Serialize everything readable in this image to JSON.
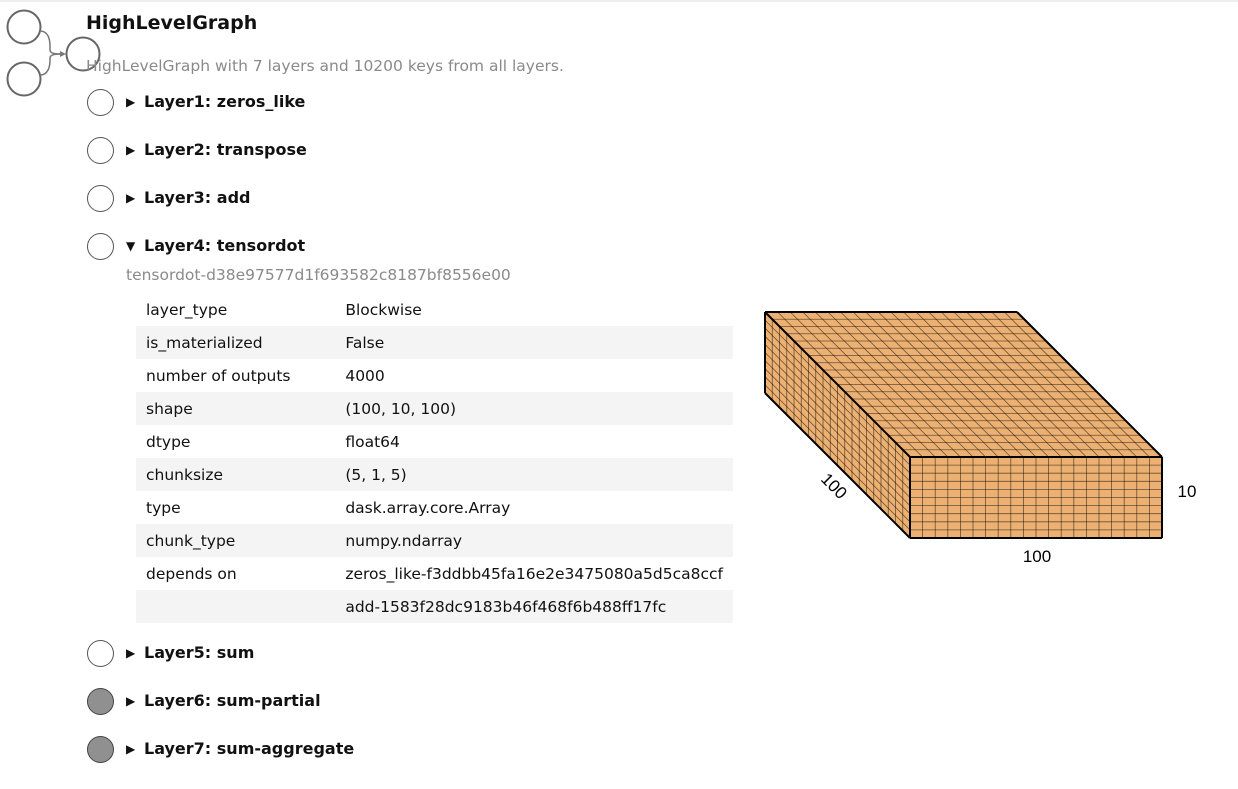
{
  "graph": {
    "title": "HighLevelGraph",
    "summary": "HighLevelGraph with 7 layers and 10200 keys from all layers."
  },
  "layers": [
    {
      "label": "Layer1: zeros_like",
      "expanded": false,
      "materialized": false
    },
    {
      "label": "Layer2: transpose",
      "expanded": false,
      "materialized": false
    },
    {
      "label": "Layer3: add",
      "expanded": false,
      "materialized": false
    },
    {
      "label": "Layer4: tensordot",
      "expanded": true,
      "materialized": false
    },
    {
      "label": "Layer5: sum",
      "expanded": false,
      "materialized": false
    },
    {
      "label": "Layer6: sum-partial",
      "expanded": false,
      "materialized": true
    },
    {
      "label": "Layer7: sum-aggregate",
      "expanded": false,
      "materialized": true
    }
  ],
  "expanded_layer": {
    "name": "tensordot-d38e97577d1f693582c8187bf8556e00",
    "rows": [
      {
        "key": "layer_type",
        "value": "Blockwise"
      },
      {
        "key": "is_materialized",
        "value": "False"
      },
      {
        "key": "number of outputs",
        "value": "4000"
      },
      {
        "key": "shape",
        "value": "(100, 10, 100)"
      },
      {
        "key": "dtype",
        "value": "float64"
      },
      {
        "key": "chunksize",
        "value": "(5, 1, 5)"
      },
      {
        "key": "type",
        "value": "dask.array.core.Array"
      },
      {
        "key": "chunk_type",
        "value": "numpy.ndarray"
      },
      {
        "key": "depends on",
        "value": "zeros_like-f3ddbb45fa16e2e3475080a5d5ca8ccf"
      },
      {
        "key": "",
        "value": "add-1583f28dc9183b46f468f6b488ff17fc"
      }
    ],
    "array_preview": {
      "shape": [
        100,
        10,
        100
      ],
      "chunks": [
        5,
        1,
        5
      ],
      "label_depth": "100",
      "label_height": "10",
      "label_width": "100",
      "fill_color": "#ECB172",
      "line_color": "#000000"
    }
  },
  "icons": {
    "caret_collapsed": "▶",
    "caret_expanded": "▼"
  }
}
